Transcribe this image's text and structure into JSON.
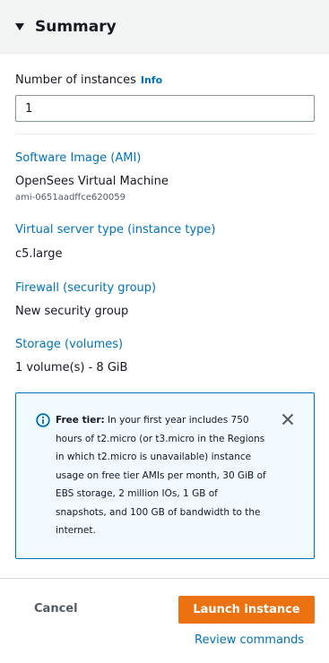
{
  "header": {
    "title": "Summary"
  },
  "instances": {
    "label": "Number of instances",
    "info_label": "Info",
    "value": "1"
  },
  "sections": [
    {
      "link": "Software Image (AMI)",
      "value": "OpenSees Virtual Machine",
      "sub": "ami-0651aadffce620059"
    },
    {
      "link": "Virtual server type (instance type)",
      "value": "c5.large"
    },
    {
      "link": "Firewall (security group)",
      "value": "New security group"
    },
    {
      "link": "Storage (volumes)",
      "value": "1 volume(s) - 8 GiB"
    }
  ],
  "alert": {
    "title": "Free tier:",
    "body": "In your first year includes 750 hours of t2.micro (or t3.micro in the Regions in which t2.micro is unavailable) instance usage on free tier AMIs per month, 30 GiB of EBS storage, 2 million IOs, 1 GB of snapshots, and 100 GB of bandwidth to the internet."
  },
  "footer": {
    "cancel_label": "Cancel",
    "launch_label": "Launch instance",
    "review_label": "Review commands"
  },
  "colors": {
    "link": "#0073bb",
    "primary_button": "#ec7211",
    "alert_bg": "#f1faff",
    "alert_border": "#0073bb"
  },
  "icons": [
    "caret-down-icon",
    "info-circle-icon",
    "close-icon"
  ]
}
